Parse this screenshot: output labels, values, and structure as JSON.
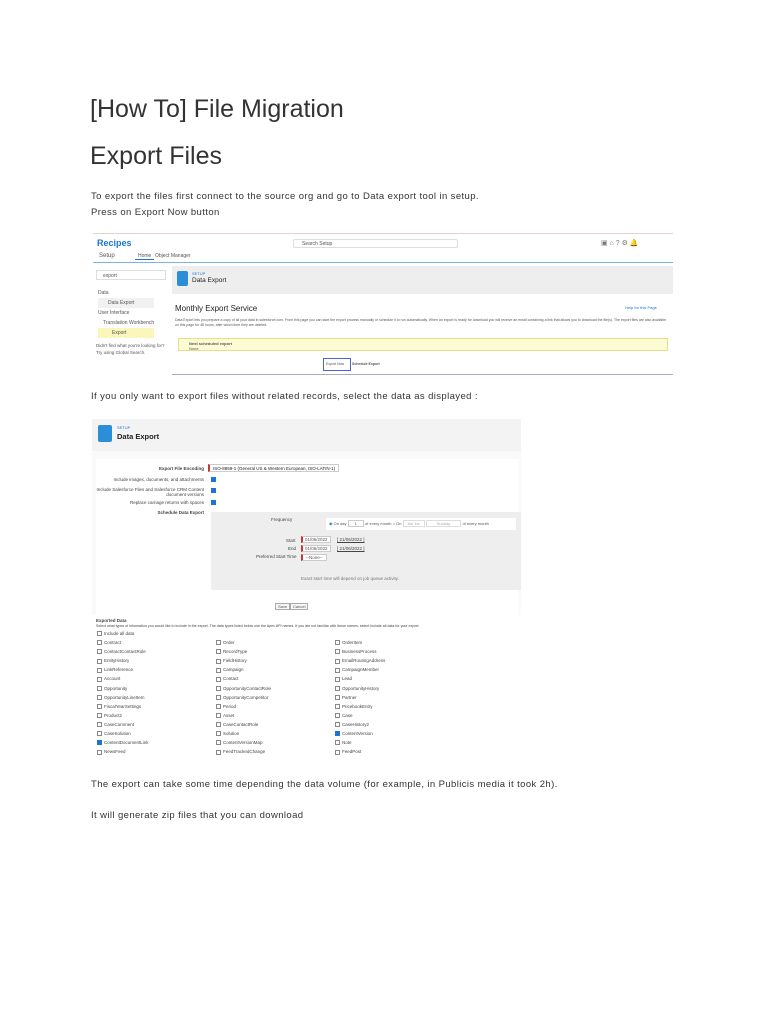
{
  "title": "[How To] File Migration",
  "heading": "Export Files",
  "para1": "To export the files first connect to the source org and go to Data export tool in setup.",
  "para2": "Press on Export Now button",
  "para3": "If you only want to export files without related records, select the data as displayed :",
  "para4": "The export can take some time depending the data volume (for example, in Publicis media it took 2h).",
  "para5": "It will generate zip files that you can download",
  "shot1": {
    "app": "Recipes",
    "search": "Search Setup",
    "setup": "Setup",
    "tab_home": "Home",
    "tab_om": "Object Manager",
    "quickfind": "export",
    "tree": [
      "Data",
      "Data Export",
      "User Interface",
      "Translation Workbench",
      "Export"
    ],
    "help": "Didn't find what you're looking for? Try using Global Search.",
    "crumb": "SETUP",
    "page": "Data Export",
    "section": "Monthly Export Service",
    "help_link": "Help for this Page",
    "desc": "Data Export lets you prepare a copy of all your data in salesforce.com. From this page you can start the export process manually or schedule it to run automatically. When an export is ready for download you will receive an email containing a link that allows you to download the file(s). The export files are also available on this page for 48 hours, after which time they are deleted.",
    "notice_title": "Next scheduled export",
    "notice_value": "None",
    "export_now": "Export Now",
    "schedule": "Schedule Export"
  },
  "shot2": {
    "crumb": "SETUP",
    "page": "Data Export",
    "encoding_label": "Export File Encoding",
    "encoding": "ISO-8859-1 (General US & Western European, ISO-LATIN-1)",
    "opt1": "Include images, documents, and attachments",
    "opt2": "Include Salesforce Files and Salesforce CRM Content document versions",
    "opt3": "Replace carriage returns with spaces",
    "schedule_label": "Schedule Data Export",
    "frequency": "Frequency",
    "on_day": "On day",
    "day": "1",
    "of_every_month": "of every month",
    "on": "On",
    "the_1st": "the 1st",
    "sunday": "Sunday",
    "start": "Start",
    "end": "End",
    "start_date": "01/06/2022",
    "end_date": "01/06/2022",
    "today": "[ 21/06/2022 ]",
    "pref_time": "Preferred Start Time",
    "none": "--None--",
    "exact_note": "Exact start time will depend on job queue activity.",
    "save": "Save",
    "cancel": "Cancel",
    "exported": "Exported Data",
    "exported_desc": "Select what types of information you would like to include in the export. The data types listed below use the Apex API names. If you are not familiar with these names, select Include all data for your export.",
    "include_all": "Include all data",
    "items": [
      {
        "label": "Contract",
        "checked": false
      },
      {
        "label": "Order",
        "checked": false
      },
      {
        "label": "OrderItem",
        "checked": false
      },
      {
        "label": "ContractContactRole",
        "checked": false
      },
      {
        "label": "RecordType",
        "checked": false
      },
      {
        "label": "BusinessProcess",
        "checked": false
      },
      {
        "label": "EntityHistory",
        "checked": false
      },
      {
        "label": "FieldHistory",
        "checked": false
      },
      {
        "label": "EmailRoutingAddress",
        "checked": false
      },
      {
        "label": "LinkReference",
        "checked": false
      },
      {
        "label": "Campaign",
        "checked": false
      },
      {
        "label": "CampaignMember",
        "checked": false
      },
      {
        "label": "Account",
        "checked": false
      },
      {
        "label": "Contact",
        "checked": false
      },
      {
        "label": "Lead",
        "checked": false
      },
      {
        "label": "Opportunity",
        "checked": false
      },
      {
        "label": "OpportunityContactRole",
        "checked": false
      },
      {
        "label": "OpportunityHistory",
        "checked": false
      },
      {
        "label": "OpportunityLineItem",
        "checked": false
      },
      {
        "label": "OpportunityCompetitor",
        "checked": false
      },
      {
        "label": "Partner",
        "checked": false
      },
      {
        "label": "FiscalYearSettings",
        "checked": false
      },
      {
        "label": "Period",
        "checked": false
      },
      {
        "label": "PricebookEntry",
        "checked": false
      },
      {
        "label": "Product2",
        "checked": false
      },
      {
        "label": "Asset",
        "checked": false
      },
      {
        "label": "Case",
        "checked": false
      },
      {
        "label": "CaseComment",
        "checked": false
      },
      {
        "label": "CaseContactRole",
        "checked": false
      },
      {
        "label": "CaseHistory2",
        "checked": false
      },
      {
        "label": "CaseSolution",
        "checked": false
      },
      {
        "label": "Solution",
        "checked": false
      },
      {
        "label": "ContentVersion",
        "checked": true
      },
      {
        "label": "ContentDocumentLink",
        "checked": true
      },
      {
        "label": "ContentVersionMap",
        "checked": false
      },
      {
        "label": "Note",
        "checked": false
      },
      {
        "label": "NewsFeed",
        "checked": false
      },
      {
        "label": "FeedTrackedChange",
        "checked": false
      },
      {
        "label": "FeedPost",
        "checked": false
      }
    ]
  }
}
